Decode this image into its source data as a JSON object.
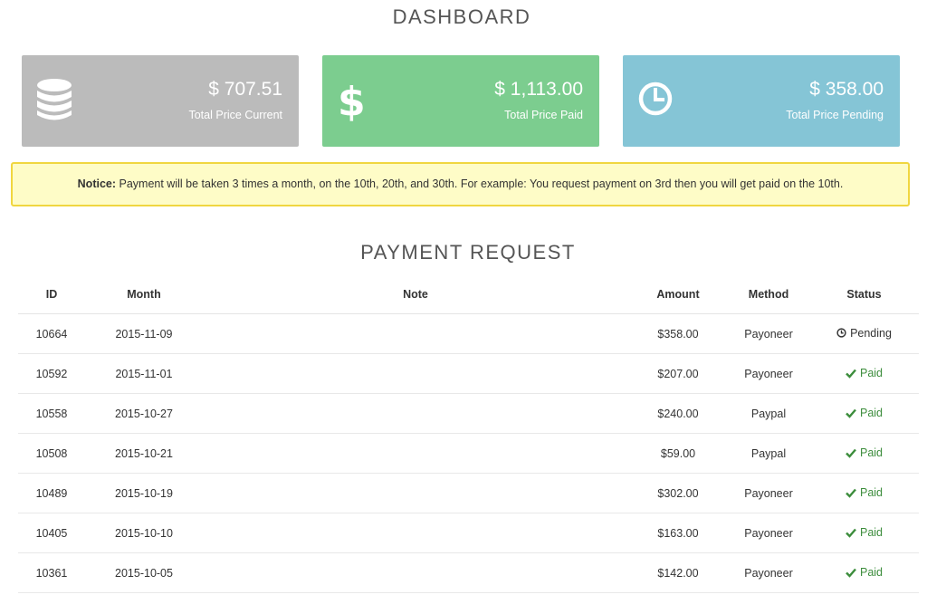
{
  "header": {
    "title": "DASHBOARD"
  },
  "stats": [
    {
      "value": "$ 707.51",
      "label": "Total Price Current",
      "icon": "database-icon",
      "color": "#bbbbbb"
    },
    {
      "value": "$ 1,113.00",
      "label": "Total Price Paid",
      "icon": "dollar-icon",
      "color": "#7ccd8f"
    },
    {
      "value": "$ 358.00",
      "label": "Total Price Pending",
      "icon": "clock-icon",
      "color": "#85c5d6"
    }
  ],
  "notice": {
    "label": "Notice:",
    "text": " Payment will be taken 3 times a month, on the 10th, 20th, and 30th. For example: You request payment on 3rd then you will get paid on the 10th.",
    "background": "#fefcc7",
    "border": "#f0d640"
  },
  "payment_request": {
    "title": "PAYMENT REQUEST",
    "columns": [
      "ID",
      "Month",
      "Note",
      "Amount",
      "Method",
      "Status"
    ],
    "rows": [
      {
        "id": "10664",
        "month": "2015-11-09",
        "note": "",
        "amount": "$358.00",
        "method": "Payoneer",
        "status": "Pending",
        "status_icon": "clock-icon"
      },
      {
        "id": "10592",
        "month": "2015-11-01",
        "note": "",
        "amount": "$207.00",
        "method": "Payoneer",
        "status": "Paid",
        "status_icon": "check-icon"
      },
      {
        "id": "10558",
        "month": "2015-10-27",
        "note": "",
        "amount": "$240.00",
        "method": "Paypal",
        "status": "Paid",
        "status_icon": "check-icon"
      },
      {
        "id": "10508",
        "month": "2015-10-21",
        "note": "",
        "amount": "$59.00",
        "method": "Paypal",
        "status": "Paid",
        "status_icon": "check-icon"
      },
      {
        "id": "10489",
        "month": "2015-10-19",
        "note": "",
        "amount": "$302.00",
        "method": "Payoneer",
        "status": "Paid",
        "status_icon": "check-icon"
      },
      {
        "id": "10405",
        "month": "2015-10-10",
        "note": "",
        "amount": "$163.00",
        "method": "Payoneer",
        "status": "Paid",
        "status_icon": "check-icon"
      },
      {
        "id": "10361",
        "month": "2015-10-05",
        "note": "",
        "amount": "$142.00",
        "method": "Payoneer",
        "status": "Paid",
        "status_icon": "check-icon"
      }
    ]
  },
  "colors": {
    "amount_text": "#a94442",
    "paid_text": "#3c8d3c"
  }
}
